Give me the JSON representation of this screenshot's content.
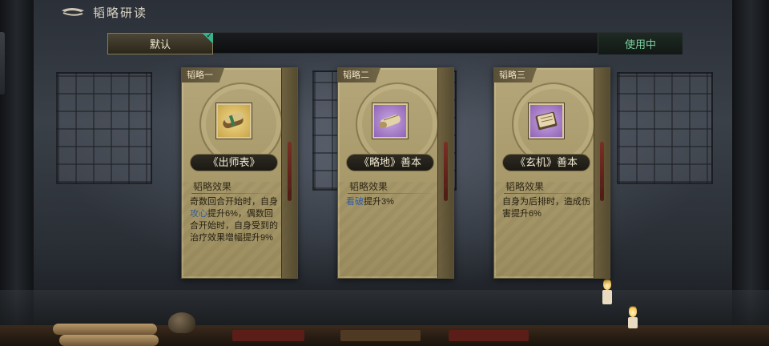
{
  "header": {
    "title": "韬略研读",
    "back_icon": "back-arrow-icon"
  },
  "tabs": {
    "default_label": "默认",
    "in_use_label": "使用中"
  },
  "cards": [
    {
      "tag": "韬略一",
      "name": "《出师表》",
      "icon": "scroll-icon",
      "icon_bg": "gold",
      "effect_title": "韬略效果",
      "effect": {
        "pre": "奇数回合开始时，自身",
        "keyword": "攻心",
        "post": "提升6%，偶数回合开始时，自身受到的治疗效果增幅提升9%"
      }
    },
    {
      "tag": "韬略二",
      "name": "《略地》善本",
      "icon": "scroll-icon",
      "icon_bg": "purple",
      "effect_title": "韬略效果",
      "effect": {
        "pre": "",
        "keyword": "看破",
        "post": "提升3%"
      }
    },
    {
      "tag": "韬略三",
      "name": "《玄机》善本",
      "icon": "book-icon",
      "icon_bg": "purple",
      "effect_title": "韬略效果",
      "effect": {
        "pre": "自身为后排时，造成伤害提升6%",
        "keyword": "",
        "post": ""
      }
    }
  ],
  "colors": {
    "keyword": "#2f5ca8",
    "in_use": "#7cd39e",
    "card_bg": "#a99b6c"
  }
}
